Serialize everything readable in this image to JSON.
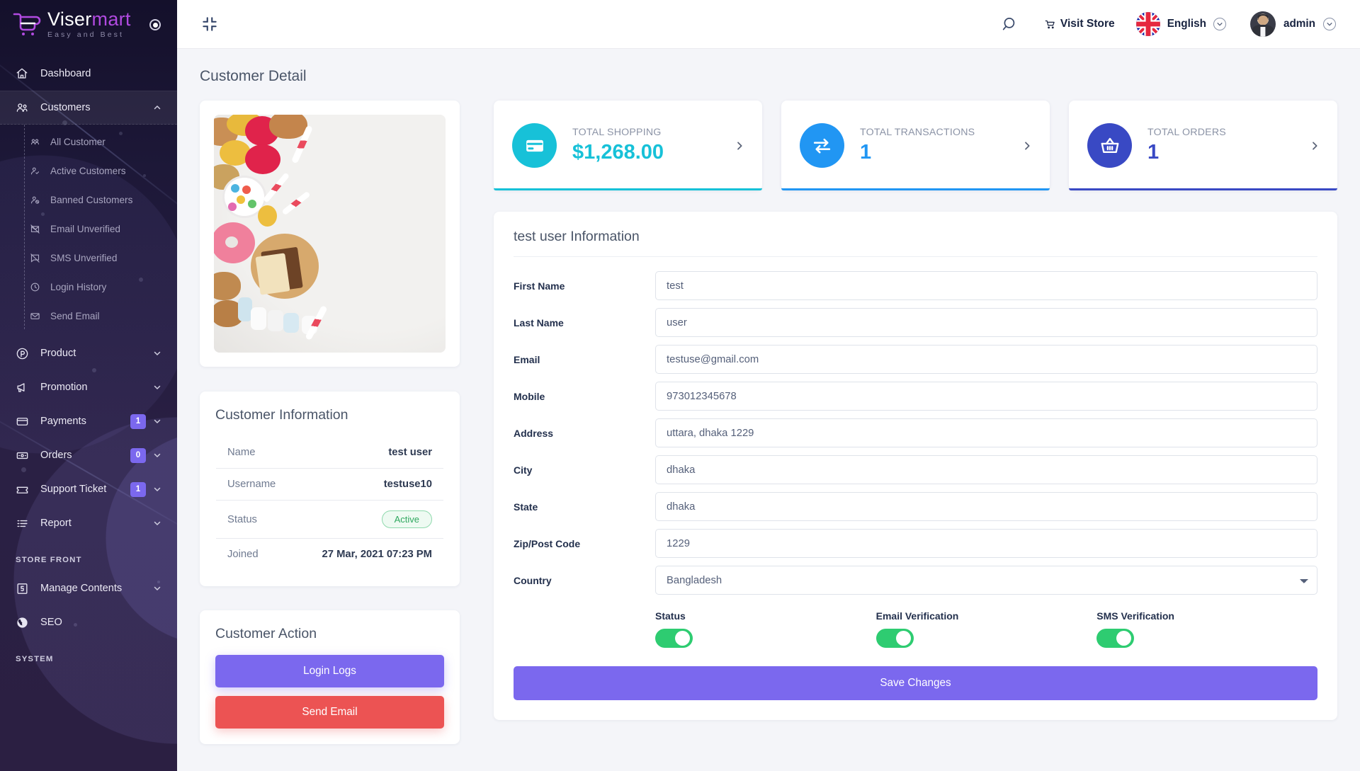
{
  "brand": {
    "name_part1": "Viser",
    "name_part2": "mart",
    "tagline": "Easy and Best"
  },
  "sidebar": {
    "items": [
      {
        "label": "Dashboard",
        "icon": "home-icon",
        "badge": null,
        "caret": false
      },
      {
        "label": "Customers",
        "icon": "users-icon",
        "badge": null,
        "caret": true,
        "active": true
      },
      {
        "label": "Product",
        "icon": "product-icon",
        "badge": null,
        "caret": true
      },
      {
        "label": "Promotion",
        "icon": "megaphone-icon",
        "badge": null,
        "caret": true
      },
      {
        "label": "Payments",
        "icon": "card-icon",
        "badge": "1",
        "caret": true
      },
      {
        "label": "Orders",
        "icon": "money-icon",
        "badge": "0",
        "caret": true
      },
      {
        "label": "Support Ticket",
        "icon": "ticket-icon",
        "badge": "1",
        "caret": true
      },
      {
        "label": "Report",
        "icon": "list-icon",
        "badge": null,
        "caret": true
      }
    ],
    "submenu": [
      {
        "label": "All Customer",
        "icon": "users-icon"
      },
      {
        "label": "Active Customers",
        "icon": "user-check-icon"
      },
      {
        "label": "Banned Customers",
        "icon": "user-ban-icon"
      },
      {
        "label": "Email Unverified",
        "icon": "mail-slash-icon"
      },
      {
        "label": "SMS Unverified",
        "icon": "sms-slash-icon"
      },
      {
        "label": "Login History",
        "icon": "clock-icon"
      },
      {
        "label": "Send Email",
        "icon": "envelope-icon"
      }
    ],
    "section_store_front": "STORE FRONT",
    "store_front_items": [
      {
        "label": "Manage Contents",
        "icon": "html5-icon",
        "caret": true
      },
      {
        "label": "SEO",
        "icon": "globe-icon",
        "caret": false
      }
    ],
    "section_system": "SYSTEM"
  },
  "topbar": {
    "collapse_icon": "collapse-icon",
    "search_icon": "search-icon",
    "visit_store_label": "Visit Store",
    "visit_store_icon": "cart-icon",
    "language": "English",
    "user": "admin"
  },
  "page": {
    "title": "Customer Detail"
  },
  "stats": [
    {
      "label": "TOTAL SHOPPING",
      "value": "$1,268.00",
      "icon": "credit-card-icon",
      "color": "#17c1d8"
    },
    {
      "label": "TOTAL TRANSACTIONS",
      "value": "1",
      "icon": "exchange-icon",
      "color": "#2196f3"
    },
    {
      "label": "TOTAL ORDERS",
      "value": "1",
      "icon": "basket-icon",
      "color": "#3949c4"
    }
  ],
  "customer_information": {
    "title": "Customer Information",
    "rows": [
      {
        "key": "Name",
        "value": "test user",
        "type": "text"
      },
      {
        "key": "Username",
        "value": "testuse10",
        "type": "text"
      },
      {
        "key": "Status",
        "value": "Active",
        "type": "badge"
      },
      {
        "key": "Joined",
        "value": "27 Mar, 2021 07:23 PM",
        "type": "text"
      }
    ]
  },
  "customer_action": {
    "title": "Customer Action",
    "login_logs_label": "Login Logs",
    "send_email_label": "Send Email"
  },
  "form": {
    "title": "test user Information",
    "fields": [
      {
        "label": "First Name",
        "value": "test",
        "type": "text"
      },
      {
        "label": "Last Name",
        "value": "user",
        "type": "text"
      },
      {
        "label": "Email",
        "value": "testuse@gmail.com",
        "type": "text"
      },
      {
        "label": "Mobile",
        "value": "973012345678",
        "type": "text"
      },
      {
        "label": "Address",
        "value": "uttara, dhaka 1229",
        "type": "text"
      },
      {
        "label": "City",
        "value": "dhaka",
        "type": "text"
      },
      {
        "label": "State",
        "value": "dhaka",
        "type": "text"
      },
      {
        "label": "Zip/Post Code",
        "value": "1229",
        "type": "text"
      },
      {
        "label": "Country",
        "value": "Bangladesh",
        "type": "select"
      }
    ],
    "toggles": [
      {
        "label": "Status",
        "on": true
      },
      {
        "label": "Email Verification",
        "on": true
      },
      {
        "label": "SMS Verification",
        "on": true
      }
    ],
    "save_label": "Save Changes"
  }
}
